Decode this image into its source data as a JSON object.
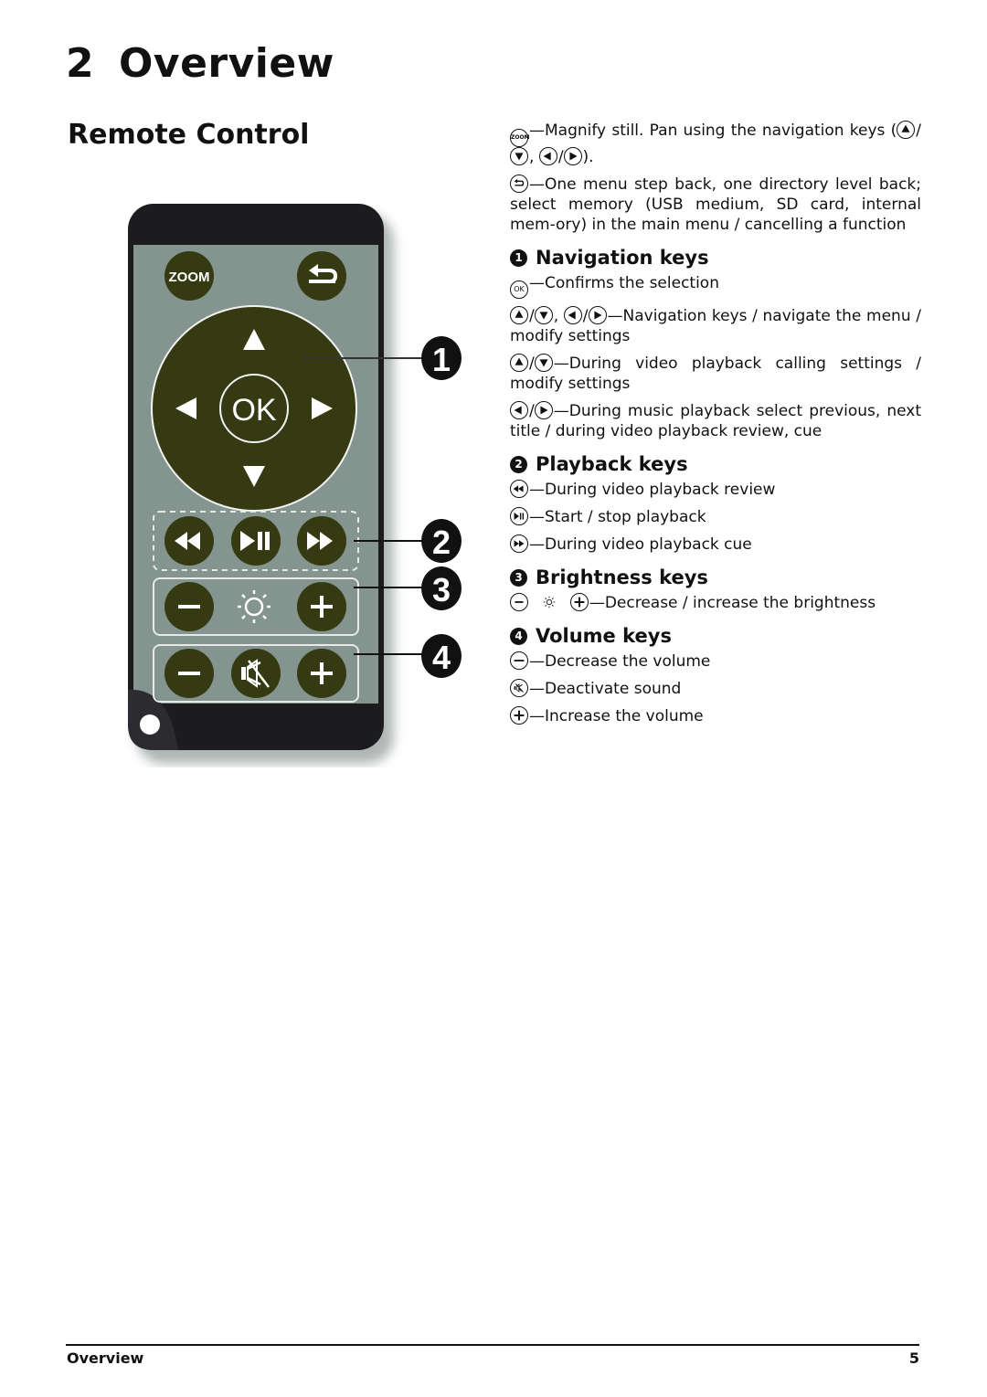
{
  "chapter": {
    "number": "2",
    "title": "Overview"
  },
  "section": {
    "title": "Remote Control"
  },
  "remote": {
    "colors": {
      "body": "#1c1c1e",
      "panel": "#84948f",
      "button": "#353a12",
      "glyph": "#ffffff"
    },
    "zoom_label": "ZOOM",
    "ok_label": "OK",
    "callouts": [
      "1",
      "2",
      "3",
      "4"
    ]
  },
  "intro": [
    {
      "keys": [
        "zoom"
      ],
      "text": "—Magnify still. Pan using the navigation keys (",
      "keys2": [
        "up"
      ],
      "sep": "/",
      "tail_keys": [
        "down"
      ],
      "tail": ", ",
      "keys3": [
        "left"
      ],
      "sep2": "/",
      "keys4": [
        "right"
      ],
      "end": ")."
    },
    {
      "keys": [
        "back"
      ],
      "text": "—One menu step back, one directory level back; select memory (USB medium, SD card, internal memory) in the main menu / cancelling a function"
    }
  ],
  "intro_text": {
    "zoom_line": "—Magnify still. Pan using the navigation keys (",
    "zoom_end": ").",
    "back_line": "—One menu step back, one directory level back; select memory (USB medium, SD card, internal mem-ory) in the main menu / cancelling a function"
  },
  "sections": [
    {
      "badge": "1",
      "title": "Navigation keys",
      "items": [
        {
          "text": "—Confirms the selection"
        },
        {
          "text": "—Navigation keys / navigate the menu / modify settings"
        },
        {
          "text": "—During video playback calling settings / modify settings"
        },
        {
          "text": "—During music playback select previous, next title / during video playback review, cue"
        }
      ]
    },
    {
      "badge": "2",
      "title": "Playback keys",
      "items": [
        {
          "text": "—During video playback review"
        },
        {
          "text": "—Start / stop playback"
        },
        {
          "text": "—During video playback cue"
        }
      ]
    },
    {
      "badge": "3",
      "title": "Brightness keys",
      "items": [
        {
          "text": "—Decrease / increase the brightness"
        }
      ]
    },
    {
      "badge": "4",
      "title": "Volume keys",
      "items": [
        {
          "text": "—Decrease the volume"
        },
        {
          "text": "—Deactivate sound"
        },
        {
          "text": "—Increase the volume"
        }
      ]
    }
  ],
  "footer": {
    "section": "Overview",
    "page": "5"
  }
}
